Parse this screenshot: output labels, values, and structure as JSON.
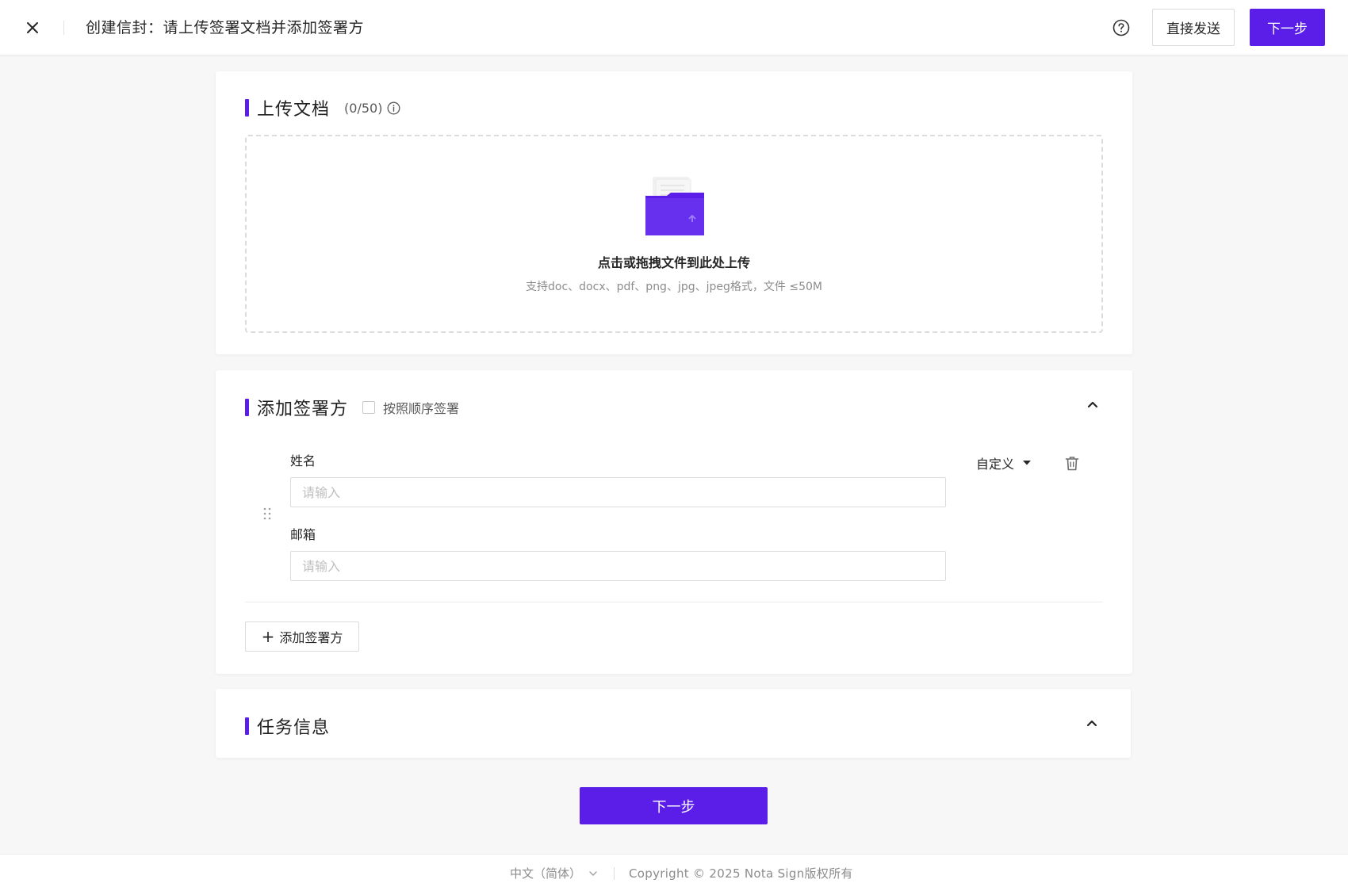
{
  "header": {
    "title": "创建信封：请上传签署文档并添加签署方",
    "send_direct_label": "直接发送",
    "next_label": "下一步"
  },
  "upload": {
    "title": "上传文档",
    "count": "(0/50)",
    "main_text": "点击或拖拽文件到此处上传",
    "sub_text": "支持doc、docx、pdf、png、jpg、jpeg格式，文件 ≤50M"
  },
  "signers": {
    "title": "添加签署方",
    "order_label": "按照顺序签署",
    "name_label": "姓名",
    "name_placeholder": "请输入",
    "email_label": "邮箱",
    "email_placeholder": "请输入",
    "role_label": "自定义",
    "add_label": "添加签署方"
  },
  "task": {
    "title": "任务信息"
  },
  "main_next_label": "下一步",
  "footer": {
    "language": "中文（简体）",
    "copyright": "Copyright © 2025 Nota Sign版权所有"
  },
  "colors": {
    "accent": "#5a1ee8",
    "background": "#f7f7f7"
  },
  "icons": [
    "close-icon",
    "help-icon",
    "info-icon",
    "folder-upload-icon",
    "chevron-up-icon",
    "drag-handle-icon",
    "caret-down-icon",
    "trash-icon",
    "plus-icon",
    "chevron-down-icon"
  ]
}
